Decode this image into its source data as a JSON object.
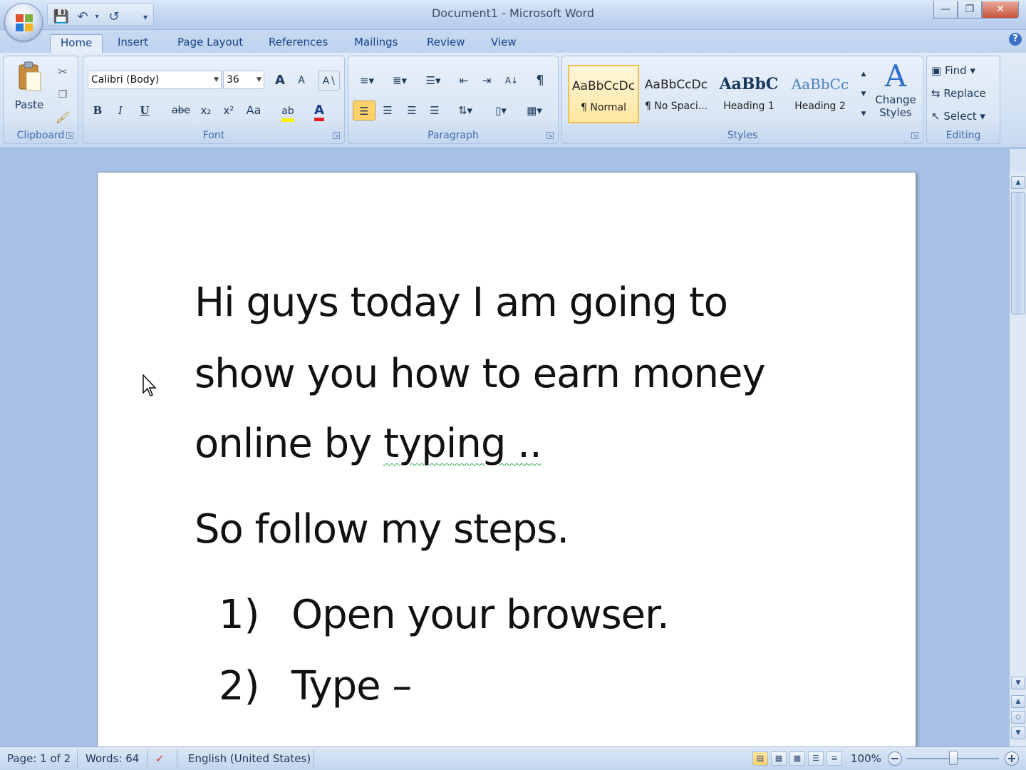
{
  "window": {
    "title": "Document1 - Microsoft Word"
  },
  "tabs": [
    "Home",
    "Insert",
    "Page Layout",
    "References",
    "Mailings",
    "Review",
    "View"
  ],
  "active_tab": "Home",
  "ribbon": {
    "clipboard": {
      "paste_label": "Paste",
      "group_label": "Clipboard"
    },
    "font": {
      "font_name": "Calibri (Body)",
      "font_size": "36",
      "bold": "B",
      "italic": "I",
      "underline": "U",
      "strike": "abe",
      "subscript": "x₂",
      "superscript": "x²",
      "change_case": "Aa",
      "grow": "A",
      "shrink": "A",
      "group_label": "Font"
    },
    "paragraph": {
      "group_label": "Paragraph",
      "show_marks": "¶",
      "sort": "A↓"
    },
    "styles": {
      "items": [
        {
          "sample": "AaBbCcDc",
          "name": "¶ Normal"
        },
        {
          "sample": "AaBbCcDc",
          "name": "¶ No Spaci..."
        },
        {
          "sample": "AaBbC",
          "name": "Heading 1"
        },
        {
          "sample": "AaBbCc",
          "name": "Heading 2"
        }
      ],
      "change_styles_label_1": "Change",
      "change_styles_label_2": "Styles",
      "group_label": "Styles"
    },
    "editing": {
      "find": "Find",
      "replace": "Replace",
      "select": "Select",
      "group_label": "Editing"
    }
  },
  "document": {
    "lines": [
      "Hi guys today I am going to",
      "show you how to earn money",
      "online by",
      "So follow my steps."
    ],
    "misspelled": "typing ..",
    "list": [
      {
        "num": "1)",
        "text": "Open your browser."
      },
      {
        "num": "2)",
        "text": "Type –"
      }
    ]
  },
  "status": {
    "page": "Page: 1 of 2",
    "words": "Words: 64",
    "language": "English (United States)",
    "zoom": "100%"
  }
}
